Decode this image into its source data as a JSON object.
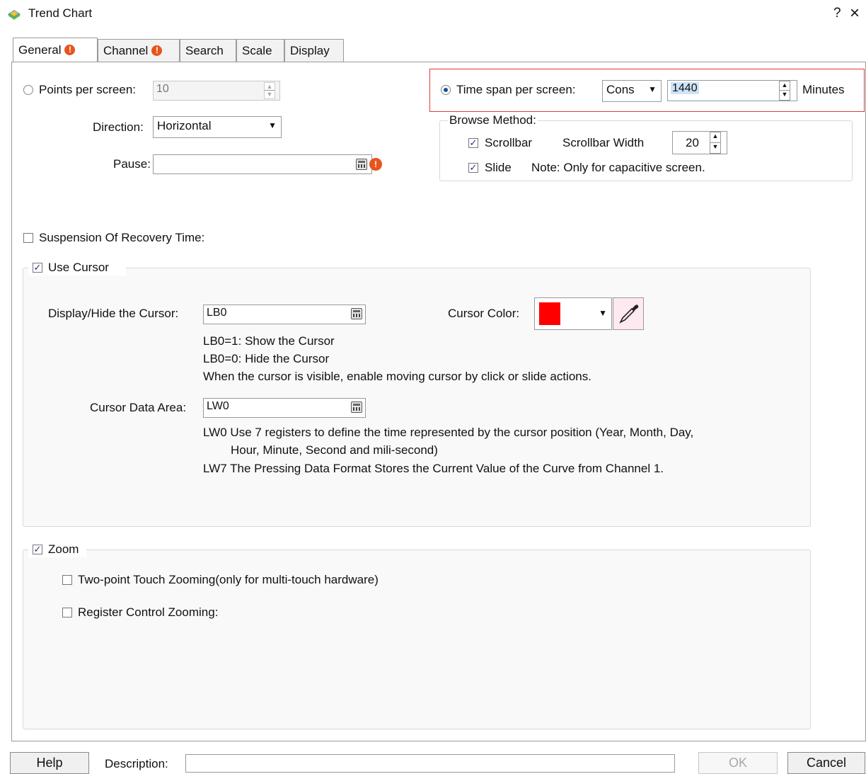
{
  "window": {
    "title": "Trend Chart",
    "help_label": "?",
    "close_label": "×"
  },
  "tabs": [
    {
      "label": "General",
      "warning": true
    },
    {
      "label": "Channel",
      "warning": true
    },
    {
      "label": "Search",
      "warning": false
    },
    {
      "label": "Scale",
      "warning": false
    },
    {
      "label": "Display",
      "warning": false
    }
  ],
  "general": {
    "points_per_screen": {
      "label": "Points per screen:",
      "value": "10",
      "selected": false
    },
    "direction": {
      "label": "Direction:",
      "value": "Horizontal"
    },
    "pause": {
      "label": "Pause:",
      "value": ""
    },
    "time_span": {
      "label": "Time span per screen:",
      "mode": "Cons",
      "value": "1440",
      "unit": "Minutes",
      "selected": true
    },
    "browse_method": {
      "title": "Browse Method:",
      "scrollbar_label": "Scrollbar",
      "scrollbar_checked": true,
      "scrollbar_width_label": "Scrollbar Width",
      "scrollbar_width_value": "20",
      "slide_label": "Slide",
      "slide_checked": true,
      "slide_note": "Note: Only for capacitive screen."
    },
    "suspension": {
      "label": "Suspension Of Recovery Time:",
      "checked": false
    },
    "use_cursor": {
      "label": "Use Cursor",
      "checked": true,
      "display_hide_label": "Display/Hide the Cursor:",
      "display_hide_value": "LB0",
      "cursor_color_label": "Cursor Color:",
      "cursor_color": "#ff0000",
      "notes": [
        "LB0=1: Show the Cursor",
        "LB0=0: Hide the Cursor",
        "When the cursor is visible, enable moving cursor by click or slide actions."
      ],
      "data_area_label": "Cursor Data Area:",
      "data_area_value": "LW0",
      "data_notes": [
        "LW0 Use 7 registers to define the time represented by the cursor position (Year, Month, Day,",
        "Hour, Minute, Second and mili-second)",
        "LW7 The Pressing Data Format Stores the Current Value of the Curve from Channel 1."
      ]
    },
    "zoom": {
      "label": "Zoom",
      "checked": true,
      "two_point_label": "Two-point Touch Zooming(only for multi-touch hardware)",
      "two_point_checked": false,
      "register_label": "Register Control Zooming:",
      "register_checked": false
    }
  },
  "footer": {
    "help_label": "Help",
    "description_label": "Description:",
    "description_value": "",
    "ok_label": "OK",
    "cancel_label": "Cancel"
  },
  "colors": {
    "highlight_border": "#e23b3b",
    "selection": "#cde3f7",
    "warning": "#e8541e"
  }
}
